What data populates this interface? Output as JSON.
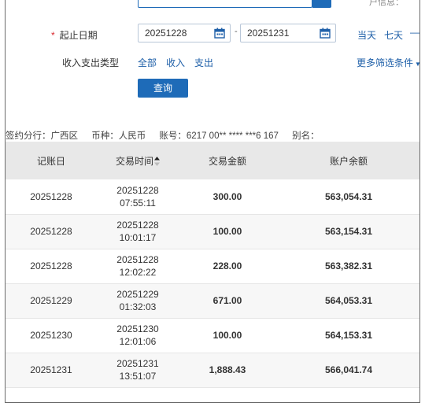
{
  "header": {
    "top_right": "户信息："
  },
  "filters": {
    "date_label": "起止日期",
    "required_mark": "*",
    "start_date": "20251228",
    "end_date": "20251231",
    "date_separator": "-",
    "quick_today": "当天",
    "quick_seven": "七天",
    "quick_dash": "—",
    "type_label": "收入支出类型",
    "type_options": [
      "全部",
      "收入",
      "支出"
    ],
    "more_filters": "更多筛选条件",
    "query_button": "查询"
  },
  "account_info": {
    "branch": "签约分行：广西区",
    "currency": "币种：人民币",
    "account_no": "账号：6217 00** **** ***6 167",
    "alias": "别名："
  },
  "table": {
    "columns": [
      "记账日",
      "交易时间",
      "交易金额",
      "账户余额"
    ],
    "rows": [
      {
        "book_date": "20251228",
        "tx_date": "20251228",
        "tx_time": "07:55:11",
        "amount": "300.00",
        "balance": "563,054.31"
      },
      {
        "book_date": "20251228",
        "tx_date": "20251228",
        "tx_time": "10:01:17",
        "amount": "100.00",
        "balance": "563,154.31"
      },
      {
        "book_date": "20251228",
        "tx_date": "20251228",
        "tx_time": "12:02:22",
        "amount": "228.00",
        "balance": "563,382.31"
      },
      {
        "book_date": "20251229",
        "tx_date": "20251229",
        "tx_time": "01:32:03",
        "amount": "671.00",
        "balance": "564,053.31"
      },
      {
        "book_date": "20251230",
        "tx_date": "20251230",
        "tx_time": "12:01:06",
        "amount": "100.00",
        "balance": "564,153.31"
      },
      {
        "book_date": "20251231",
        "tx_date": "20251231",
        "tx_time": "13:51:07",
        "amount": "1,888.43",
        "balance": "566,041.74"
      }
    ]
  },
  "colors": {
    "primary": "#1e6bb8",
    "amount_red": "#d9262c",
    "header_gray": "#e8e8e8"
  }
}
